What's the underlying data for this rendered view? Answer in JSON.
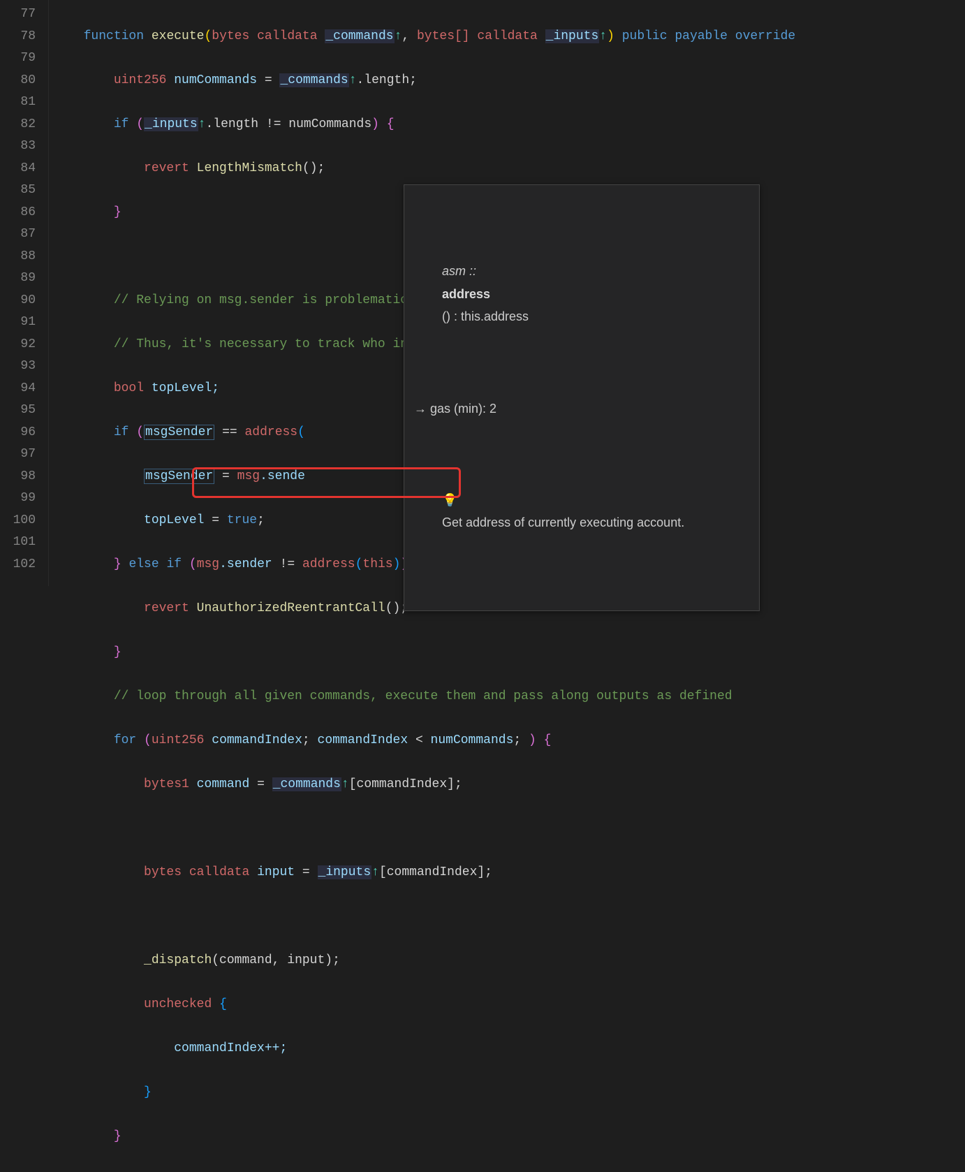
{
  "line_numbers": [
    "77",
    "78",
    "79",
    "80",
    "81",
    "82",
    "83",
    "84",
    "85",
    "86",
    "87",
    "88",
    "89",
    "90",
    "91",
    "92",
    "93",
    "94",
    "95",
    "96",
    "97",
    "98",
    "99",
    "100",
    "101",
    "102"
  ],
  "tooltip": {
    "sig_prefix": "asm ::",
    "sig_keyword": "address",
    "sig_suffix": "() : this.address",
    "gas_line": "→ gas (min): 2",
    "hint": "Get address of currently executing account."
  },
  "code": {
    "l77": {
      "function": "function",
      "execute": "execute",
      "bytes": "bytes",
      "calldata": "calldata",
      "commands": "_commands",
      "bytesarr": "bytes[]",
      "inputs": "_inputs",
      "public": "public",
      "payable": "payable",
      "override": "override"
    },
    "l78": {
      "uint256": "uint256",
      "numCommands": "numCommands",
      "eq": " = ",
      "commands": "_commands",
      "dot": ".length;"
    },
    "l79": {
      "if": "if",
      "inputs": "_inputs",
      "rest": ".length != numCommands"
    },
    "l80": {
      "revert": "revert",
      "err": "LengthMismatch",
      "rest": "();"
    },
    "l83": {
      "c": "// Relying on msg.sender is problematic as it changes during a flash loan."
    },
    "l84": {
      "c": "// Thus, it's necessary to track who initiated the original Router execution."
    },
    "l85": {
      "bool": "bool",
      "topLevel": "topLevel;"
    },
    "l86": {
      "if": "if",
      "msgSender": "msgSender",
      "eq": " == ",
      "address": "address"
    },
    "l87": {
      "msgSender": "msgSender",
      "eq": " = ",
      "msg": "msg",
      "sender": ".sende"
    },
    "l88": {
      "topLevel": "topLevel",
      "eq": " = ",
      "true": "true",
      "semi": ";"
    },
    "l89": {
      "else": "else",
      "if": "if",
      "msg": "msg",
      "dotsender": ".sender",
      "neq": " != ",
      "address": "address",
      "this": "this"
    },
    "l90": {
      "revert": "revert",
      "err": "UnauthorizedReentrantCall",
      "rest": "();"
    },
    "l92": {
      "c": "// loop through all given commands, execute them and pass along outputs as defined"
    },
    "l93": {
      "for": "for",
      "uint256": "uint256",
      "commandIndex": "commandIndex",
      "lt": " < ",
      "numCommands": "numCommands"
    },
    "l94": {
      "bytes1": "bytes1",
      "command": "command",
      "eq": " = ",
      "commands": "_commands",
      "idx": "[commandIndex];"
    },
    "l96": {
      "bytes": "bytes",
      "calldata": "calldata",
      "input": "input",
      "eq": " = ",
      "inputs": "_inputs",
      "idx": "[commandIndex];"
    },
    "l98": {
      "dispatch": "_dispatch",
      "args": "(command, input);"
    },
    "l99": {
      "unchecked": "unchecked"
    },
    "l100": {
      "inc": "commandIndex++;"
    }
  }
}
